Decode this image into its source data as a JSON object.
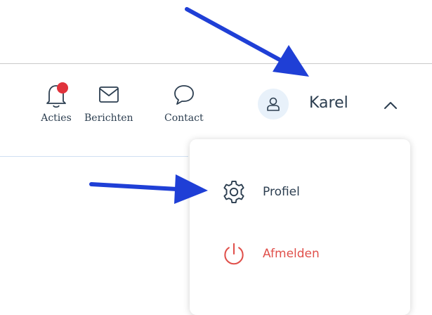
{
  "header": {
    "nav": [
      {
        "label": "Acties",
        "icon": "bell-icon",
        "badge_color": "#e0323b"
      },
      {
        "label": "Berichten",
        "icon": "envelope-icon"
      },
      {
        "label": "Contact",
        "icon": "chat-bubble-icon"
      }
    ],
    "user": {
      "name": "Karel",
      "avatar_icon": "user-icon",
      "menu_state_icon": "chevron-up-icon"
    }
  },
  "user_menu": {
    "items": [
      {
        "label": "Profiel",
        "icon": "gear-icon",
        "color": "#2c3e50"
      },
      {
        "label": "Afmelden",
        "icon": "power-icon",
        "color": "#e0504b"
      }
    ]
  },
  "annotations": {
    "arrow_color": "#1f3fd6"
  },
  "colors": {
    "text": "#2c3e50",
    "accent_bg": "#e8f1fa",
    "danger": "#e0504b"
  }
}
